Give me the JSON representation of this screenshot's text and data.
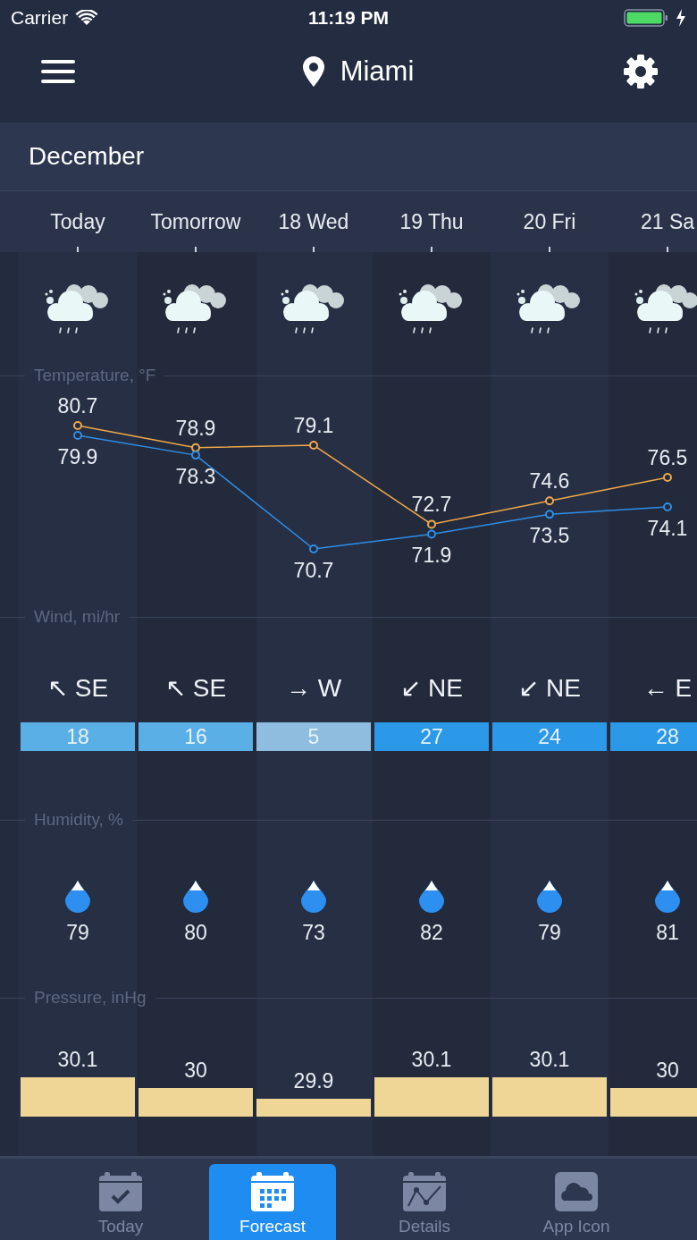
{
  "status_bar": {
    "carrier": "Carrier",
    "time": "11:19 PM"
  },
  "nav": {
    "city": "Miami"
  },
  "month": "December",
  "days": [
    "Today",
    "Tomorrow",
    "18 Wed",
    "19 Thu",
    "20 Fri",
    "21 Sa"
  ],
  "temperature": {
    "chart_data": {
      "type": "line",
      "title": "Temperature, °F",
      "data_labels": true,
      "series": [
        {
          "color": "#f0a848",
          "marker": "o",
          "values": [
            80.7,
            78.9,
            79.1,
            72.7,
            74.6,
            76.5
          ]
        },
        {
          "color": "#2f8fe8",
          "marker": "o",
          "values": [
            79.9,
            78.3,
            70.7,
            71.9,
            73.5,
            74.1
          ]
        }
      ]
    }
  },
  "wind": {
    "title": "Wind, mi/hr",
    "items": [
      {
        "arrow": "↖",
        "direction": "SE",
        "speed": "18",
        "color": "#5aafe6"
      },
      {
        "arrow": "↖",
        "direction": "SE",
        "speed": "16",
        "color": "#5aafe6"
      },
      {
        "arrow": "→",
        "direction": "W",
        "speed": "5",
        "color": "#8fbde0"
      },
      {
        "arrow": "↙",
        "direction": "NE",
        "speed": "27",
        "color": "#2b98e8"
      },
      {
        "arrow": "↙",
        "direction": "NE",
        "speed": "24",
        "color": "#2b98e8"
      },
      {
        "arrow": "←",
        "direction": "E",
        "speed": "28",
        "color": "#2b98e8"
      }
    ]
  },
  "humidity": {
    "title": "Humidity, %",
    "values": [
      "79",
      "80",
      "73",
      "82",
      "79",
      "81"
    ]
  },
  "pressure": {
    "title": "Pressure, inHg",
    "values": [
      "30.1",
      "30",
      "29.9",
      "30.1",
      "30.1",
      "30"
    ]
  },
  "tabs": [
    {
      "label": "Today",
      "kind": "check",
      "selected": false
    },
    {
      "label": "Forecast",
      "kind": "grid",
      "selected": true
    },
    {
      "label": "Details",
      "kind": "chart",
      "selected": false
    },
    {
      "label": "App Icon",
      "kind": "cloud",
      "selected": false
    }
  ]
}
